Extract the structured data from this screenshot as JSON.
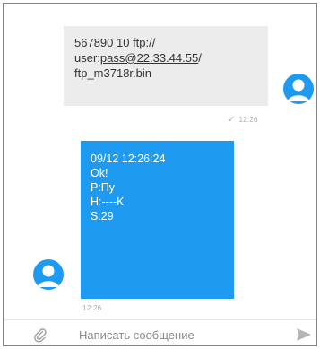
{
  "outgoing_message": {
    "lines": {
      "line1": "567890 10 ftp://",
      "line2_prefix": "user:",
      "line2_link": "pass@22.33.44.55",
      "line2_suffix": "/",
      "line3": "ftp_m3718r.bin"
    },
    "status_icon": "check-icon",
    "time": "12:26"
  },
  "incoming_message": {
    "lines": [
      "09/12 12:26:24",
      "Ok!",
      "P:Пу",
      "H:----K",
      "S:29"
    ],
    "time": "12:26"
  },
  "compose": {
    "placeholder": "Написать сообщение",
    "value": "",
    "attach_icon": "paperclip-icon",
    "send_icon": "send-icon"
  },
  "colors": {
    "accent": "#1e9bf0",
    "outgoing_bubble": "#ececec",
    "meta_text": "#b0b0b0",
    "frame_border": "#4a90d9"
  }
}
